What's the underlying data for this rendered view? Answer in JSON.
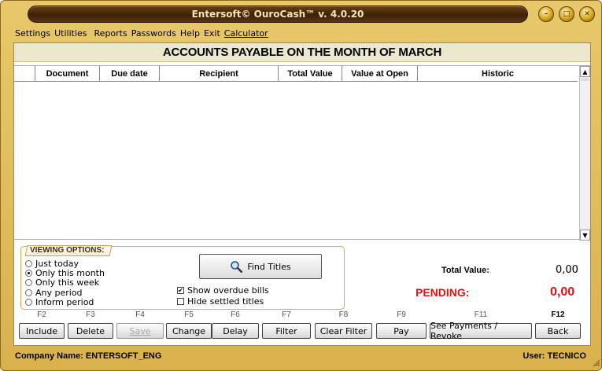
{
  "window": {
    "title": "Entersoft© OuroCash™ v. 4.0.20"
  },
  "menu": [
    "Settings",
    "Utilities",
    "Reports",
    "Passwords",
    "Help",
    "Exit",
    "Calculator"
  ],
  "heading": "ACCOUNTS PAYABLE ON THE MONTH OF MARCH",
  "grid": {
    "columns": [
      "",
      "Document",
      "Due date",
      "Recipient",
      "Total Value",
      "Value at Open",
      "Historic"
    ],
    "rows": []
  },
  "viewing": {
    "label": "VIEWING OPTIONS:",
    "options": [
      "Just today",
      "Only this month",
      "Only this week",
      "Any period",
      "Inform period"
    ],
    "selected": "Only this month",
    "find_button": "Find Titles",
    "checks": [
      {
        "label": "Show overdue bills",
        "checked": true
      },
      {
        "label": "Hide settled titles",
        "checked": false
      }
    ]
  },
  "totals": {
    "total_label": "Total Value:",
    "total_value": "0,00",
    "pending_label": "PENDING:",
    "pending_value": "0,00",
    "pending_color": "#e01414"
  },
  "fkeys": [
    {
      "key": "F2",
      "label": "Include",
      "enabled": true
    },
    {
      "key": "F3",
      "label": "Delete",
      "enabled": true
    },
    {
      "key": "F4",
      "label": "Save",
      "enabled": false
    },
    {
      "key": "F5",
      "label": "Change",
      "enabled": true
    },
    {
      "key": "F6",
      "label": "Delay",
      "enabled": true
    },
    {
      "key": "F7",
      "label": "Filter",
      "enabled": true
    },
    {
      "key": "F8",
      "label": "Clear Filter",
      "enabled": true
    },
    {
      "key": "F9",
      "label": "Pay",
      "enabled": true
    },
    {
      "key": "F11",
      "label": "See Payments / Revoke",
      "enabled": true
    },
    {
      "key": "F12",
      "label": "Back",
      "enabled": true
    }
  ],
  "status": {
    "company": "Company Name: ENTERSOFT_ENG",
    "user": "User: TECNICO"
  },
  "colors": {
    "frame": "#d9b24e",
    "title_pill": "#3e2208",
    "heading_bg": "#ece7cf",
    "viewing_border": "#e6a24a"
  }
}
